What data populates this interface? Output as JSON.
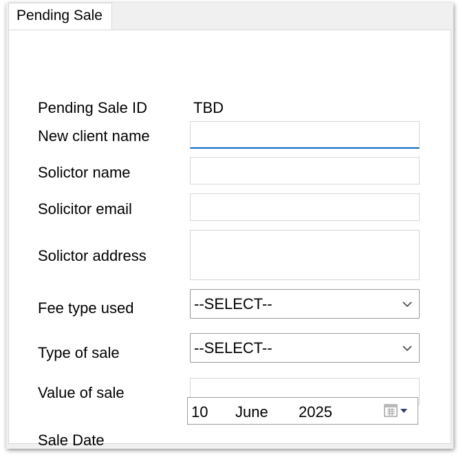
{
  "tab": {
    "label": "Pending Sale"
  },
  "form": {
    "pending_sale_id": {
      "label": "Pending Sale ID",
      "value": "TBD"
    },
    "new_client_name": {
      "label": "New client name",
      "value": ""
    },
    "solicitor_name": {
      "label": "Solictor name",
      "value": ""
    },
    "solicitor_email": {
      "label": "Solicitor email",
      "value": ""
    },
    "solicitor_address": {
      "label": "Solictor address",
      "value": ""
    },
    "fee_type_used": {
      "label": "Fee type used",
      "selected": "--SELECT--"
    },
    "type_of_sale": {
      "label": "Type of sale",
      "selected": "--SELECT--"
    },
    "value_of_sale": {
      "label": "Value of sale",
      "value": ""
    },
    "sale_date": {
      "label": "Sale Date",
      "day": "10",
      "month": "June",
      "year": "2025"
    }
  },
  "icons": {
    "dropdown": "chevron-down-icon",
    "calendar": "calendar-icon"
  },
  "colors": {
    "focus_accent": "#0a64c2",
    "border": "#d6d6d6"
  }
}
